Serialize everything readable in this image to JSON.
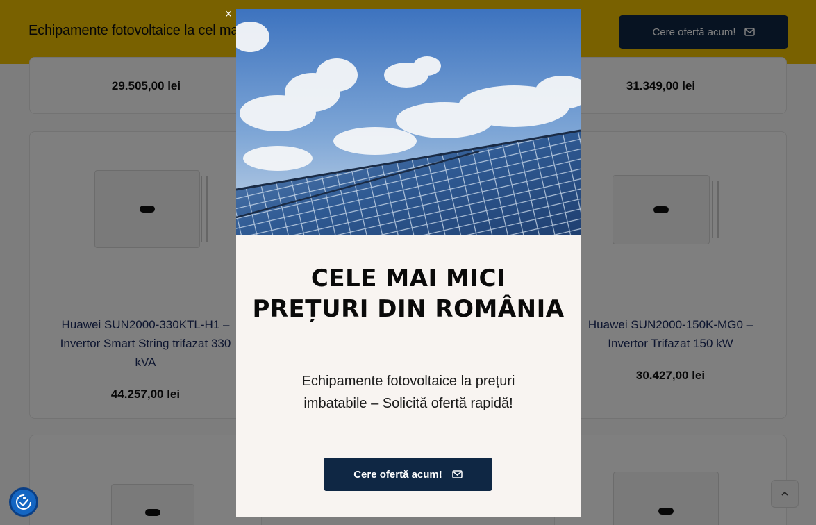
{
  "topbar": {
    "title": "Echipamente fotovoltaice la cel mai bun preț",
    "cta_label": "Cere ofertă acum!",
    "cta_icon": "mail-icon",
    "background": "#f2c200"
  },
  "products": [
    {
      "price": "29.505,00 lei"
    },
    {
      "price": "31.349,00 lei"
    },
    {
      "name": "Huawei SUN2000-330KTL-H1 – Invertor Smart String trifazat 330 kVA",
      "price": "44.257,00 lei"
    },
    {
      "name": "Huawei SUN2000-150K-MG0 – Invertor Trifazat 150 kW",
      "price": "30.427,00 lei"
    }
  ],
  "modal": {
    "close_label": "×",
    "headline": "CELE MAI MICI PREȚURI DIN ROMÂNIA",
    "subtitle": "Echipamente fotovoltaice la prețuri imbatabile – Solicită ofertă rapidă!",
    "cta_label": "Cere ofertă acum!",
    "cta_icon": "mail-icon",
    "cta_color": "#0f2744"
  },
  "widgets": {
    "accessibility_icon": "accessibility-icon",
    "scroll_top_label": "^"
  }
}
